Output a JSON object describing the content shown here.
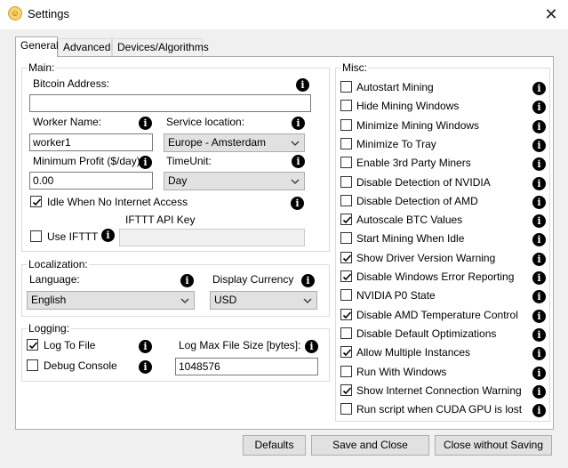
{
  "window": {
    "title": "Settings",
    "close_glyph": "✕"
  },
  "tabs": [
    "General",
    "Advanced",
    "Devices/Algorithms"
  ],
  "main": {
    "legend": "Main:",
    "bitcoin_address_label": "Bitcoin Address:",
    "bitcoin_address_value": "",
    "worker_name_label": "Worker Name:",
    "worker_name_value": "worker1",
    "service_location_label": "Service location:",
    "service_location_value": "Europe - Amsterdam",
    "min_profit_label": "Minimum Profit ($/day):",
    "min_profit_value": "0.00",
    "time_unit_label": "TimeUnit:",
    "time_unit_value": "Day",
    "idle_label": "Idle When No Internet Access",
    "idle_checked": true,
    "use_ifttt_label": "Use IFTTT",
    "use_ifttt_checked": false,
    "ifttt_key_label": "IFTTT API Key",
    "ifttt_key_value": ""
  },
  "localization": {
    "legend": "Localization:",
    "language_label": "Language:",
    "language_value": "English",
    "currency_label": "Display Currency",
    "currency_value": "USD"
  },
  "logging": {
    "legend": "Logging:",
    "log_to_file_label": "Log To File",
    "log_to_file_checked": true,
    "debug_console_label": "Debug Console",
    "debug_console_checked": false,
    "max_size_label": "Log Max File Size [bytes]:",
    "max_size_value": "1048576"
  },
  "misc": {
    "legend": "Misc:",
    "items": [
      {
        "label": "Autostart Mining",
        "checked": false
      },
      {
        "label": "Hide Mining Windows",
        "checked": false
      },
      {
        "label": "Minimize Mining Windows",
        "checked": false
      },
      {
        "label": "Minimize To Tray",
        "checked": false
      },
      {
        "label": "Enable 3rd Party Miners",
        "checked": false
      },
      {
        "label": "Disable Detection of NVIDIA",
        "checked": false
      },
      {
        "label": "Disable Detection of AMD",
        "checked": false
      },
      {
        "label": "Autoscale BTC Values",
        "checked": true
      },
      {
        "label": "Start Mining When Idle",
        "checked": false
      },
      {
        "label": "Show Driver Version Warning",
        "checked": true
      },
      {
        "label": "Disable Windows Error Reporting",
        "checked": true
      },
      {
        "label": "NVIDIA P0 State",
        "checked": false
      },
      {
        "label": "Disable AMD Temperature Control",
        "checked": true
      },
      {
        "label": "Disable Default Optimizations",
        "checked": false
      },
      {
        "label": "Allow Multiple Instances",
        "checked": true
      },
      {
        "label": "Run With Windows",
        "checked": false
      },
      {
        "label": "Show Internet Connection Warning",
        "checked": true
      },
      {
        "label": "Run script when CUDA GPU is lost",
        "checked": false
      }
    ]
  },
  "buttons": {
    "defaults": "Defaults",
    "save_close": "Save and Close",
    "close_no_save": "Close without Saving"
  },
  "icons": {
    "info": "i",
    "app": "☺"
  }
}
